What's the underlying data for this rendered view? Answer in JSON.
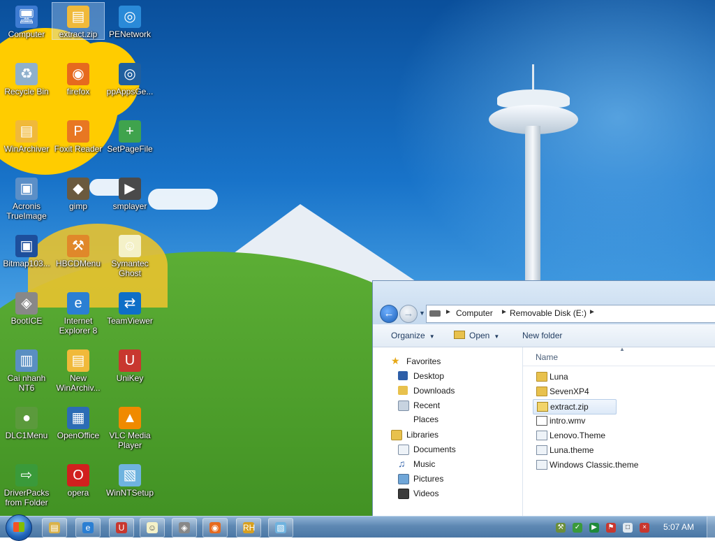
{
  "desktop": {
    "icons": [
      {
        "label": "Computer",
        "icon": "computer-icon",
        "color": "#3d7bd1"
      },
      {
        "label": "extract.zip",
        "icon": "zip-archive-icon",
        "color": "#f0b93a"
      },
      {
        "label": "PENetwork",
        "icon": "network-globe-icon",
        "color": "#2a8ad8"
      },
      {
        "label": "Recycle Bin",
        "icon": "recycle-bin-icon",
        "color": "#8fb0cc"
      },
      {
        "label": "firefox",
        "icon": "firefox-icon",
        "color": "#e66a1e"
      },
      {
        "label": "ppAppsGe...",
        "icon": "ppapps-icon",
        "color": "#1f5f9f"
      },
      {
        "label": "WinArchiver",
        "icon": "winarchiver-icon",
        "color": "#f0b93a"
      },
      {
        "label": "Foxit Reader",
        "icon": "pdf-icon",
        "color": "#e87722"
      },
      {
        "label": "SetPageFile",
        "icon": "setpagefile-icon",
        "color": "#3fa34d"
      },
      {
        "label": "Acronis TrueImage",
        "icon": "acronis-icon",
        "color": "#5b8fc7"
      },
      {
        "label": "gimp",
        "icon": "gimp-icon",
        "color": "#6b5a3e"
      },
      {
        "label": "smplayer",
        "icon": "smplayer-icon",
        "color": "#4a4a4a"
      },
      {
        "label": "Bitmap103...",
        "icon": "bitmap-icon",
        "color": "#1d4f9c"
      },
      {
        "label": "HBCDMenu",
        "icon": "tools-icon",
        "color": "#e0882a"
      },
      {
        "label": "Symantec Ghost",
        "icon": "ghost-icon",
        "color": "#f4f1c8"
      },
      {
        "label": "BootICE",
        "icon": "bootice-icon",
        "color": "#888888"
      },
      {
        "label": "Internet Explorer 8",
        "icon": "internet-explorer-icon",
        "color": "#2b7fd3"
      },
      {
        "label": "TeamViewer",
        "icon": "teamviewer-icon",
        "color": "#0e6fc7"
      },
      {
        "label": "Cai nhanh NT6",
        "icon": "installer-icon",
        "color": "#5a8fc2"
      },
      {
        "label": "New WinArchiv...",
        "icon": "winarchiver-icon",
        "color": "#f0b93a"
      },
      {
        "label": "UniKey",
        "icon": "unikey-icon",
        "color": "#c8372f"
      },
      {
        "label": "DLC1Menu",
        "icon": "dlc-menu-icon",
        "color": "#5b9a3c"
      },
      {
        "label": "OpenOffice",
        "icon": "openoffice-icon",
        "color": "#2c6cb5"
      },
      {
        "label": "VLC Media Player",
        "icon": "vlc-icon",
        "color": "#f08a00"
      },
      {
        "label": "DriverPacks from Folder",
        "icon": "driverpacks-icon",
        "color": "#3a9a3a"
      },
      {
        "label": "opera",
        "icon": "opera-icon",
        "color": "#d1201e"
      },
      {
        "label": "WinNTSetup",
        "icon": "winntsetup-icon",
        "color": "#6fb3df"
      }
    ]
  },
  "explorer": {
    "breadcrumb": [
      "Computer",
      "Removable Disk (E:)"
    ],
    "toolbar": {
      "organize": "Organize",
      "open": "Open",
      "new_folder": "New folder"
    },
    "nav": {
      "favorites": "Favorites",
      "favorites_items": [
        "Desktop",
        "Downloads",
        "Recent Places"
      ],
      "libraries": "Libraries",
      "libraries_items": [
        "Documents",
        "Music",
        "Pictures",
        "Videos"
      ]
    },
    "column_name": "Name",
    "files": [
      {
        "name": "Luna",
        "type": "folder"
      },
      {
        "name": "SevenXP4",
        "type": "folder"
      },
      {
        "name": "extract.zip",
        "type": "zip",
        "selected": true
      },
      {
        "name": "intro.wmv",
        "type": "wmv"
      },
      {
        "name": "Lenovo.Theme",
        "type": "theme"
      },
      {
        "name": "Luna.theme",
        "type": "theme"
      },
      {
        "name": "Windows Classic.theme",
        "type": "theme"
      }
    ]
  },
  "taskbar": {
    "clock": "5:07 AM",
    "pinned": [
      "explorer-icon",
      "internet-explorer-icon",
      "unikey-icon",
      "ghost-icon",
      "bootice-icon",
      "firefox-icon",
      "rh-icon",
      "winntsetup-icon"
    ],
    "tray": [
      "network-tools-icon",
      "shield-icon",
      "play-icon",
      "flag-icon",
      "monitor-icon",
      "volume-muted-icon"
    ]
  },
  "colors": {
    "accent": "#1f63b8",
    "selection": "#dde9f8"
  }
}
